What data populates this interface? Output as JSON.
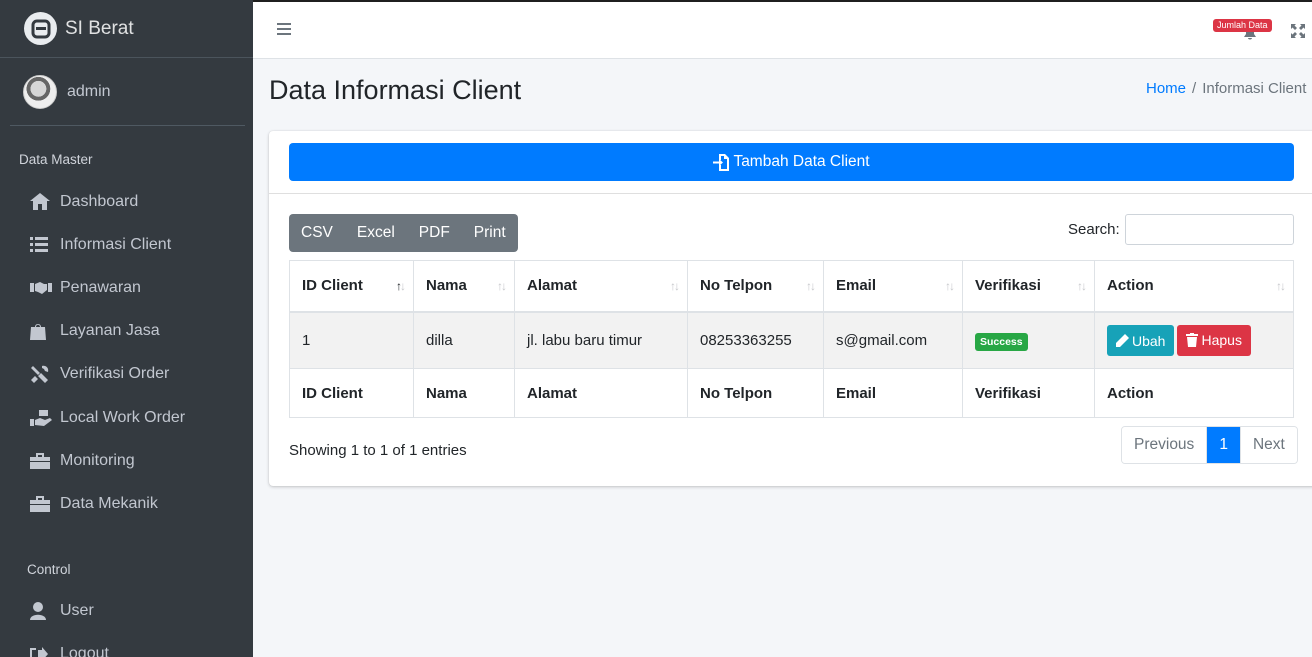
{
  "brand": {
    "title": "SI Berat",
    "logo_icon": "brand-logo-icon"
  },
  "user": {
    "name": "admin"
  },
  "sidebar": {
    "header_master": "Data Master",
    "items": [
      {
        "label": "Dashboard",
        "icon": "home-icon"
      },
      {
        "label": "Informasi Client",
        "icon": "list-icon"
      },
      {
        "label": "Penawaran",
        "icon": "handshake-icon"
      },
      {
        "label": "Layanan Jasa",
        "icon": "shopping-bag-icon"
      },
      {
        "label": "Verifikasi Order",
        "icon": "tools-icon"
      },
      {
        "label": "Local Work Order",
        "icon": "hand-holding-icon"
      },
      {
        "label": "Monitoring",
        "icon": "toolbox-icon"
      },
      {
        "label": "Data Mekanik",
        "icon": "toolbox-icon"
      }
    ],
    "header_control": "Control",
    "control_items": [
      {
        "label": "User",
        "icon": "user-icon"
      },
      {
        "label": "Logout",
        "icon": "logout-icon"
      }
    ]
  },
  "topbar": {
    "notif_badge": "Jumlah Data"
  },
  "page": {
    "title": "Data Informasi Client"
  },
  "breadcrumb": {
    "home": "Home",
    "separator": "/",
    "current": "Informasi Client"
  },
  "card": {
    "add_button": "Tambah Data Client",
    "export_buttons": [
      "CSV",
      "Excel",
      "PDF",
      "Print"
    ],
    "search_label": "Search:",
    "search_value": ""
  },
  "table": {
    "columns": [
      "ID Client",
      "Nama",
      "Alamat",
      "No Telpon",
      "Email",
      "Verifikasi",
      "Action"
    ],
    "rows": [
      {
        "id": "1",
        "nama": "dilla",
        "alamat": "jl. labu baru timur",
        "telpon": "08253363255",
        "email": "s@gmail.com",
        "verifikasi": "Success",
        "ubah": "Ubah",
        "hapus": "Hapus"
      }
    ]
  },
  "footer": {
    "showing": "Showing 1 to 1 of 1 entries",
    "previous": "Previous",
    "page": "1",
    "next": "Next"
  },
  "colors": {
    "primary": "#007bff",
    "sidebar": "#343a40",
    "success": "#28a745",
    "info": "#17a2b8",
    "danger": "#dc3545"
  }
}
